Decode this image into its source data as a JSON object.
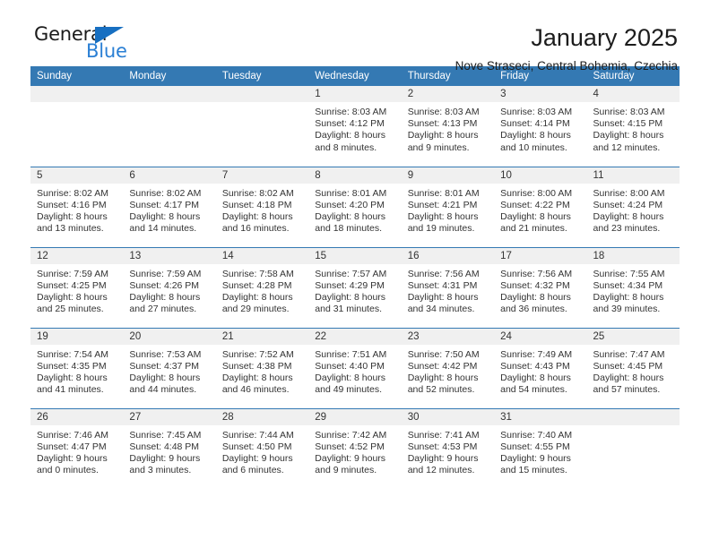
{
  "brand": {
    "name_top": "General",
    "name_bottom": "Blue",
    "triangle_icon": "triangle-icon",
    "color_dark": "#1b1b1b",
    "color_blue": "#2a7fd4"
  },
  "header": {
    "title": "January 2025",
    "subtitle": "Nove Straseci, Central Bohemia, Czechia"
  },
  "colors": {
    "header_blue": "#3479b3",
    "daynum_gray": "#f0f0f0",
    "text": "#333333"
  },
  "calendar": {
    "weekdays": [
      "Sunday",
      "Monday",
      "Tuesday",
      "Wednesday",
      "Thursday",
      "Friday",
      "Saturday"
    ],
    "labels": {
      "sunrise": "Sunrise:",
      "sunset": "Sunset:",
      "daylight": "Daylight:"
    },
    "weeks": [
      [
        {
          "day": "",
          "blank": true,
          "sunrise": "",
          "sunset": "",
          "daylight_line1": "",
          "daylight_line2": ""
        },
        {
          "day": "",
          "blank": true,
          "sunrise": "",
          "sunset": "",
          "daylight_line1": "",
          "daylight_line2": ""
        },
        {
          "day": "",
          "blank": true,
          "sunrise": "",
          "sunset": "",
          "daylight_line1": "",
          "daylight_line2": ""
        },
        {
          "day": "1",
          "blank": false,
          "sunrise": "Sunrise: 8:03 AM",
          "sunset": "Sunset: 4:12 PM",
          "daylight_line1": "Daylight: 8 hours",
          "daylight_line2": "and 8 minutes."
        },
        {
          "day": "2",
          "blank": false,
          "sunrise": "Sunrise: 8:03 AM",
          "sunset": "Sunset: 4:13 PM",
          "daylight_line1": "Daylight: 8 hours",
          "daylight_line2": "and 9 minutes."
        },
        {
          "day": "3",
          "blank": false,
          "sunrise": "Sunrise: 8:03 AM",
          "sunset": "Sunset: 4:14 PM",
          "daylight_line1": "Daylight: 8 hours",
          "daylight_line2": "and 10 minutes."
        },
        {
          "day": "4",
          "blank": false,
          "sunrise": "Sunrise: 8:03 AM",
          "sunset": "Sunset: 4:15 PM",
          "daylight_line1": "Daylight: 8 hours",
          "daylight_line2": "and 12 minutes."
        }
      ],
      [
        {
          "day": "5",
          "blank": false,
          "sunrise": "Sunrise: 8:02 AM",
          "sunset": "Sunset: 4:16 PM",
          "daylight_line1": "Daylight: 8 hours",
          "daylight_line2": "and 13 minutes."
        },
        {
          "day": "6",
          "blank": false,
          "sunrise": "Sunrise: 8:02 AM",
          "sunset": "Sunset: 4:17 PM",
          "daylight_line1": "Daylight: 8 hours",
          "daylight_line2": "and 14 minutes."
        },
        {
          "day": "7",
          "blank": false,
          "sunrise": "Sunrise: 8:02 AM",
          "sunset": "Sunset: 4:18 PM",
          "daylight_line1": "Daylight: 8 hours",
          "daylight_line2": "and 16 minutes."
        },
        {
          "day": "8",
          "blank": false,
          "sunrise": "Sunrise: 8:01 AM",
          "sunset": "Sunset: 4:20 PM",
          "daylight_line1": "Daylight: 8 hours",
          "daylight_line2": "and 18 minutes."
        },
        {
          "day": "9",
          "blank": false,
          "sunrise": "Sunrise: 8:01 AM",
          "sunset": "Sunset: 4:21 PM",
          "daylight_line1": "Daylight: 8 hours",
          "daylight_line2": "and 19 minutes."
        },
        {
          "day": "10",
          "blank": false,
          "sunrise": "Sunrise: 8:00 AM",
          "sunset": "Sunset: 4:22 PM",
          "daylight_line1": "Daylight: 8 hours",
          "daylight_line2": "and 21 minutes."
        },
        {
          "day": "11",
          "blank": false,
          "sunrise": "Sunrise: 8:00 AM",
          "sunset": "Sunset: 4:24 PM",
          "daylight_line1": "Daylight: 8 hours",
          "daylight_line2": "and 23 minutes."
        }
      ],
      [
        {
          "day": "12",
          "blank": false,
          "sunrise": "Sunrise: 7:59 AM",
          "sunset": "Sunset: 4:25 PM",
          "daylight_line1": "Daylight: 8 hours",
          "daylight_line2": "and 25 minutes."
        },
        {
          "day": "13",
          "blank": false,
          "sunrise": "Sunrise: 7:59 AM",
          "sunset": "Sunset: 4:26 PM",
          "daylight_line1": "Daylight: 8 hours",
          "daylight_line2": "and 27 minutes."
        },
        {
          "day": "14",
          "blank": false,
          "sunrise": "Sunrise: 7:58 AM",
          "sunset": "Sunset: 4:28 PM",
          "daylight_line1": "Daylight: 8 hours",
          "daylight_line2": "and 29 minutes."
        },
        {
          "day": "15",
          "blank": false,
          "sunrise": "Sunrise: 7:57 AM",
          "sunset": "Sunset: 4:29 PM",
          "daylight_line1": "Daylight: 8 hours",
          "daylight_line2": "and 31 minutes."
        },
        {
          "day": "16",
          "blank": false,
          "sunrise": "Sunrise: 7:56 AM",
          "sunset": "Sunset: 4:31 PM",
          "daylight_line1": "Daylight: 8 hours",
          "daylight_line2": "and 34 minutes."
        },
        {
          "day": "17",
          "blank": false,
          "sunrise": "Sunrise: 7:56 AM",
          "sunset": "Sunset: 4:32 PM",
          "daylight_line1": "Daylight: 8 hours",
          "daylight_line2": "and 36 minutes."
        },
        {
          "day": "18",
          "blank": false,
          "sunrise": "Sunrise: 7:55 AM",
          "sunset": "Sunset: 4:34 PM",
          "daylight_line1": "Daylight: 8 hours",
          "daylight_line2": "and 39 minutes."
        }
      ],
      [
        {
          "day": "19",
          "blank": false,
          "sunrise": "Sunrise: 7:54 AM",
          "sunset": "Sunset: 4:35 PM",
          "daylight_line1": "Daylight: 8 hours",
          "daylight_line2": "and 41 minutes."
        },
        {
          "day": "20",
          "blank": false,
          "sunrise": "Sunrise: 7:53 AM",
          "sunset": "Sunset: 4:37 PM",
          "daylight_line1": "Daylight: 8 hours",
          "daylight_line2": "and 44 minutes."
        },
        {
          "day": "21",
          "blank": false,
          "sunrise": "Sunrise: 7:52 AM",
          "sunset": "Sunset: 4:38 PM",
          "daylight_line1": "Daylight: 8 hours",
          "daylight_line2": "and 46 minutes."
        },
        {
          "day": "22",
          "blank": false,
          "sunrise": "Sunrise: 7:51 AM",
          "sunset": "Sunset: 4:40 PM",
          "daylight_line1": "Daylight: 8 hours",
          "daylight_line2": "and 49 minutes."
        },
        {
          "day": "23",
          "blank": false,
          "sunrise": "Sunrise: 7:50 AM",
          "sunset": "Sunset: 4:42 PM",
          "daylight_line1": "Daylight: 8 hours",
          "daylight_line2": "and 52 minutes."
        },
        {
          "day": "24",
          "blank": false,
          "sunrise": "Sunrise: 7:49 AM",
          "sunset": "Sunset: 4:43 PM",
          "daylight_line1": "Daylight: 8 hours",
          "daylight_line2": "and 54 minutes."
        },
        {
          "day": "25",
          "blank": false,
          "sunrise": "Sunrise: 7:47 AM",
          "sunset": "Sunset: 4:45 PM",
          "daylight_line1": "Daylight: 8 hours",
          "daylight_line2": "and 57 minutes."
        }
      ],
      [
        {
          "day": "26",
          "blank": false,
          "sunrise": "Sunrise: 7:46 AM",
          "sunset": "Sunset: 4:47 PM",
          "daylight_line1": "Daylight: 9 hours",
          "daylight_line2": "and 0 minutes."
        },
        {
          "day": "27",
          "blank": false,
          "sunrise": "Sunrise: 7:45 AM",
          "sunset": "Sunset: 4:48 PM",
          "daylight_line1": "Daylight: 9 hours",
          "daylight_line2": "and 3 minutes."
        },
        {
          "day": "28",
          "blank": false,
          "sunrise": "Sunrise: 7:44 AM",
          "sunset": "Sunset: 4:50 PM",
          "daylight_line1": "Daylight: 9 hours",
          "daylight_line2": "and 6 minutes."
        },
        {
          "day": "29",
          "blank": false,
          "sunrise": "Sunrise: 7:42 AM",
          "sunset": "Sunset: 4:52 PM",
          "daylight_line1": "Daylight: 9 hours",
          "daylight_line2": "and 9 minutes."
        },
        {
          "day": "30",
          "blank": false,
          "sunrise": "Sunrise: 7:41 AM",
          "sunset": "Sunset: 4:53 PM",
          "daylight_line1": "Daylight: 9 hours",
          "daylight_line2": "and 12 minutes."
        },
        {
          "day": "31",
          "blank": false,
          "sunrise": "Sunrise: 7:40 AM",
          "sunset": "Sunset: 4:55 PM",
          "daylight_line1": "Daylight: 9 hours",
          "daylight_line2": "and 15 minutes."
        },
        {
          "day": "",
          "blank": true,
          "sunrise": "",
          "sunset": "",
          "daylight_line1": "",
          "daylight_line2": ""
        }
      ]
    ]
  }
}
